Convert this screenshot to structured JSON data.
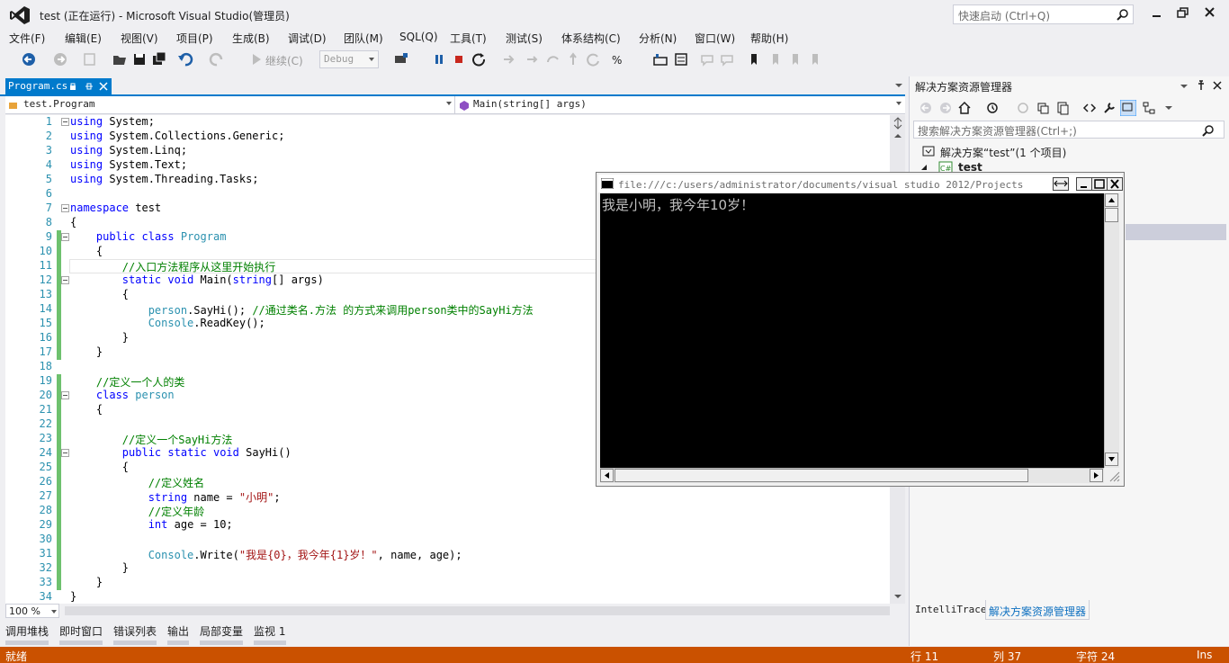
{
  "window": {
    "title": "test (正在运行) - Microsoft Visual Studio(管理员)",
    "quick_launch_placeholder": "快速启动 (Ctrl+Q)"
  },
  "menu": [
    "文件(F)",
    "编辑(E)",
    "视图(V)",
    "项目(P)",
    "生成(B)",
    "调试(D)",
    "团队(M)",
    "SQL(Q)",
    "工具(T)",
    "测试(S)",
    "体系结构(C)",
    "分析(N)",
    "窗口(W)",
    "帮助(H)"
  ],
  "toolbar": {
    "continue_label": "继续(C)",
    "config_value": "Debug"
  },
  "document_tab": {
    "name": "Program.cs"
  },
  "navbar": {
    "type_value": "test.Program",
    "member_value": "Main(string[] args)"
  },
  "editor": {
    "zoom": "100 %",
    "lines": [
      {
        "n": "1",
        "html": "<span class=\"kw\">using</span> System;"
      },
      {
        "n": "2",
        "html": "<span class=\"kw\">using</span> System.Collections.Generic;"
      },
      {
        "n": "3",
        "html": "<span class=\"kw\">using</span> System.Linq;"
      },
      {
        "n": "4",
        "html": "<span class=\"kw\">using</span> System.Text;"
      },
      {
        "n": "5",
        "html": "<span class=\"kw\">using</span> System.Threading.Tasks;"
      },
      {
        "n": "6",
        "html": ""
      },
      {
        "n": "7",
        "html": "<span class=\"kw\">namespace</span> test"
      },
      {
        "n": "8",
        "html": "{"
      },
      {
        "n": "9",
        "html": "    <span class=\"kw\">public</span> <span class=\"kw\">class</span> <span class=\"ty\">Program</span>"
      },
      {
        "n": "10",
        "html": "    {"
      },
      {
        "n": "11",
        "html": "        <span class=\"cm\">//入口方法程序从这里开始执行</span>"
      },
      {
        "n": "12",
        "html": "        <span class=\"kw\">static</span> <span class=\"kw\">void</span> Main(<span class=\"kw\">string</span>[] args)"
      },
      {
        "n": "13",
        "html": "        {"
      },
      {
        "n": "14",
        "html": "            <span class=\"ty\">person</span>.SayHi(); <span class=\"cm\">//通过类名.方法 的方式来调用person类中的SayHi方法</span>"
      },
      {
        "n": "15",
        "html": "            <span class=\"ty\">Console</span>.ReadKey();"
      },
      {
        "n": "16",
        "html": "        }"
      },
      {
        "n": "17",
        "html": "    }"
      },
      {
        "n": "18",
        "html": ""
      },
      {
        "n": "19",
        "html": "    <span class=\"cm\">//定义一个人的类</span>"
      },
      {
        "n": "20",
        "html": "    <span class=\"kw\">class</span> <span class=\"ty\">person</span>"
      },
      {
        "n": "21",
        "html": "    {"
      },
      {
        "n": "22",
        "html": ""
      },
      {
        "n": "23",
        "html": "        <span class=\"cm\">//定义一个SayHi方法</span>"
      },
      {
        "n": "24",
        "html": "        <span class=\"kw\">public</span> <span class=\"kw\">static</span> <span class=\"kw\">void</span> SayHi()"
      },
      {
        "n": "25",
        "html": "        {"
      },
      {
        "n": "26",
        "html": "            <span class=\"cm\">//定义姓名</span>"
      },
      {
        "n": "27",
        "html": "            <span class=\"kw\">string</span> name = <span class=\"st\">\"小明\"</span>;"
      },
      {
        "n": "28",
        "html": "            <span class=\"cm\">//定义年龄</span>"
      },
      {
        "n": "29",
        "html": "            <span class=\"kw\">int</span> age = 10;"
      },
      {
        "n": "30",
        "html": ""
      },
      {
        "n": "31",
        "html": "            <span class=\"ty\">Console</span>.Write(<span class=\"st\">\"我是{0}，我今年{1}岁！\"</span>, name, age);"
      },
      {
        "n": "32",
        "html": "        }"
      },
      {
        "n": "33",
        "html": "    }"
      },
      {
        "n": "34",
        "html": "}"
      }
    ]
  },
  "bottom_tabs": [
    "调用堆栈",
    "即时窗口",
    "错误列表",
    "输出",
    "局部变量",
    "监视 1"
  ],
  "status": {
    "state": "就绪",
    "line": "行 11",
    "col": "列 37",
    "char": "字符 24",
    "mode": "Ins"
  },
  "solution_explorer": {
    "title": "解决方案资源管理器",
    "search_placeholder": "搜索解决方案资源管理器(Ctrl+;)",
    "solution_label": "解决方案“test”(1 个项目)",
    "project_label": "test",
    "tabs": [
      "IntelliTrace",
      "解决方案资源管理器"
    ]
  },
  "console": {
    "title": "file:///c:/users/administrator/documents/visual studio 2012/Projects",
    "output": "我是小明，我今年10岁！"
  },
  "colors": {
    "accent": "#007acc",
    "status_bar": "#ca5100"
  }
}
